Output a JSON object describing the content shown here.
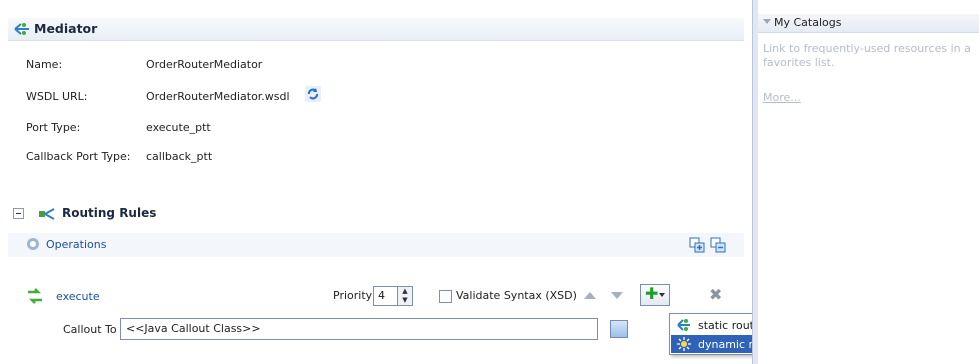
{
  "mediator": {
    "title": "Mediator",
    "fields": [
      {
        "label": "Name:",
        "value": "OrderRouterMediator"
      },
      {
        "label": "WSDL URL:",
        "value": "OrderRouterMediator.wsdl"
      },
      {
        "label": "Port Type:",
        "value": "execute_ptt"
      },
      {
        "label": "Callback Port Type:",
        "value": "callback_ptt"
      }
    ]
  },
  "routing_rules": {
    "title": "Routing Rules",
    "operations_label": "Operations",
    "operation": {
      "name": "execute",
      "priority_label": "Priority",
      "priority_value": "4",
      "validate_label": "Validate Syntax (XSD)",
      "validate_checked": false,
      "callout_label": "Callout To",
      "callout_value": "<<Java Callout Class>>"
    }
  },
  "add_menu": {
    "items": [
      {
        "label": "static routing rule",
        "icon": "static-routing-icon",
        "selected": false
      },
      {
        "label": "dynamic routing with decision component",
        "icon": "dynamic-routing-icon",
        "selected": true
      }
    ]
  },
  "catalogs": {
    "title": "My Catalogs",
    "description_line1": "Link to frequently-used resources in a",
    "description_line2": "favorites list.",
    "more_link": "More..."
  },
  "colors": {
    "link_blue": "#1d4fa3",
    "selection_blue": "#2f63b7",
    "add_green": "#1f9e2a"
  }
}
